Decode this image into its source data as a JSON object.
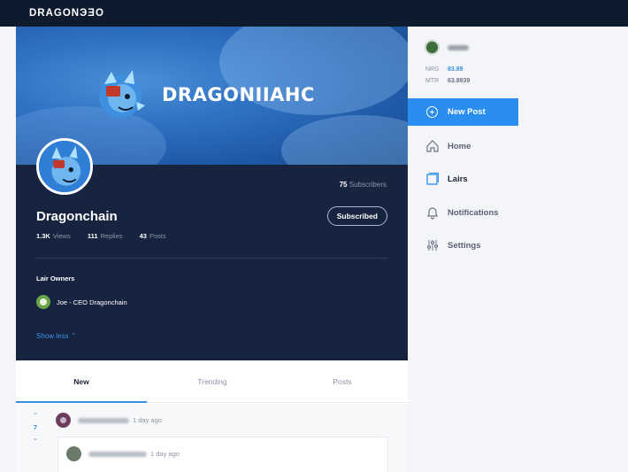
{
  "header": {
    "logo": "DRAGONЭƎO"
  },
  "banner": {
    "wordmark": "DRAGONCHAIN",
    "wordmark_display": "DRAGONIIAHC"
  },
  "lair": {
    "subscribers_count": "75",
    "subscribers_label": "Subscribers",
    "name": "Dragonchain",
    "subscribe_button": "Subscribed",
    "stats": [
      {
        "value": "1.3K",
        "label": "Views"
      },
      {
        "value": "111",
        "label": "Replies"
      },
      {
        "value": "43",
        "label": "Posts"
      }
    ],
    "owners_title": "Lair Owners",
    "owners": [
      {
        "name": "Joe - CEO Dragonchain"
      }
    ],
    "show_less": "Show less"
  },
  "tabs": [
    {
      "label": "New"
    },
    {
      "label": "Trending"
    },
    {
      "label": "Posts"
    }
  ],
  "feed": {
    "post": {
      "votes": "7",
      "time": "1 day ago"
    },
    "reply": {
      "time": "1 day ago"
    }
  },
  "sidebar": {
    "balances": [
      {
        "label": "NRG",
        "value": "83.89"
      },
      {
        "label": "MTR",
        "value": "63.8939"
      }
    ],
    "new_post": "New Post",
    "nav": [
      {
        "label": "Home",
        "icon": "home-icon"
      },
      {
        "label": "Lairs",
        "icon": "lairs-icon"
      },
      {
        "label": "Notifications",
        "icon": "bell-icon"
      },
      {
        "label": "Settings",
        "icon": "sliders-icon"
      }
    ]
  },
  "colors": {
    "accent": "#2a8ef0",
    "topbar": "#0e1a2e",
    "profile_bg": "#162440"
  }
}
